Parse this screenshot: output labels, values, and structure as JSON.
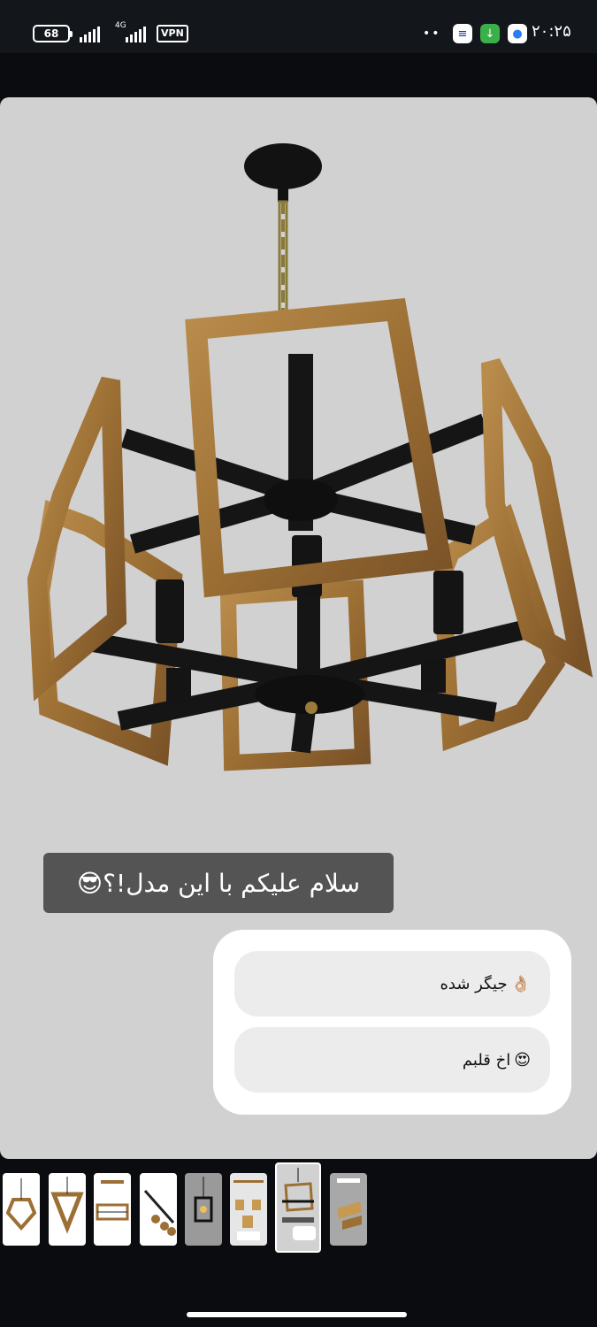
{
  "status_bar": {
    "battery": "68",
    "network_label": "4G",
    "vpn_label": "VPN",
    "dots": "••",
    "time": "۲۰:۲۵",
    "icons": [
      "wifi-signal-icon",
      "mobile-signal-icon",
      "vpn-icon",
      "bee-app-icon",
      "download-icon",
      "chat-app-icon"
    ]
  },
  "story": {
    "caption": "سلام علیکم با این مدل!؟😎",
    "poll": {
      "options": [
        {
          "text": "جیگر شده",
          "emoji": "👌🏼"
        },
        {
          "text": "اخ قلبم",
          "emoji": "😍"
        }
      ]
    }
  },
  "thumbnails": {
    "count": 8,
    "active_index": 6,
    "background_colors": [
      "#ffffff",
      "#ffffff",
      "#ffffff",
      "#ffffff",
      "#9a9a9a",
      "#e6e6e6",
      "#d1d1d1",
      "#a8a8a8"
    ]
  },
  "colors": {
    "story_bg": "#d1d1d1",
    "caption_bg": "#545454",
    "wood": "#a57a3e",
    "metal": "#141414"
  }
}
